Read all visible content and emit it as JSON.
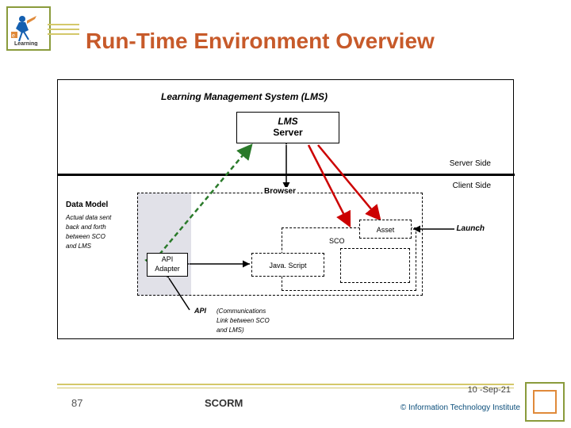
{
  "title": "Run-Time Environment Overview",
  "diagram": {
    "lms_label": "Learning Management System (LMS)",
    "lms_server_l1": "LMS",
    "lms_server_l2": "Server",
    "server_side": "Server Side",
    "client_side": "Client Side",
    "browser": "Browser",
    "data_model": "Data Model",
    "data_model_sub": "Actual data sent\nback and forth\nbetween SCO\nand LMS",
    "sco": "SCO",
    "api_l1": "API",
    "api_l2": "Adapter",
    "js": "Java. Script",
    "asset": "Asset",
    "launch": "Launch",
    "api_note_label": "API",
    "api_note": "(Communications\nLink between SCO\nand LMS)"
  },
  "footer": {
    "page": "87",
    "scorm": "SCORM",
    "date": "10 -Sep-21",
    "copyright": "© Information Technology Institute"
  }
}
